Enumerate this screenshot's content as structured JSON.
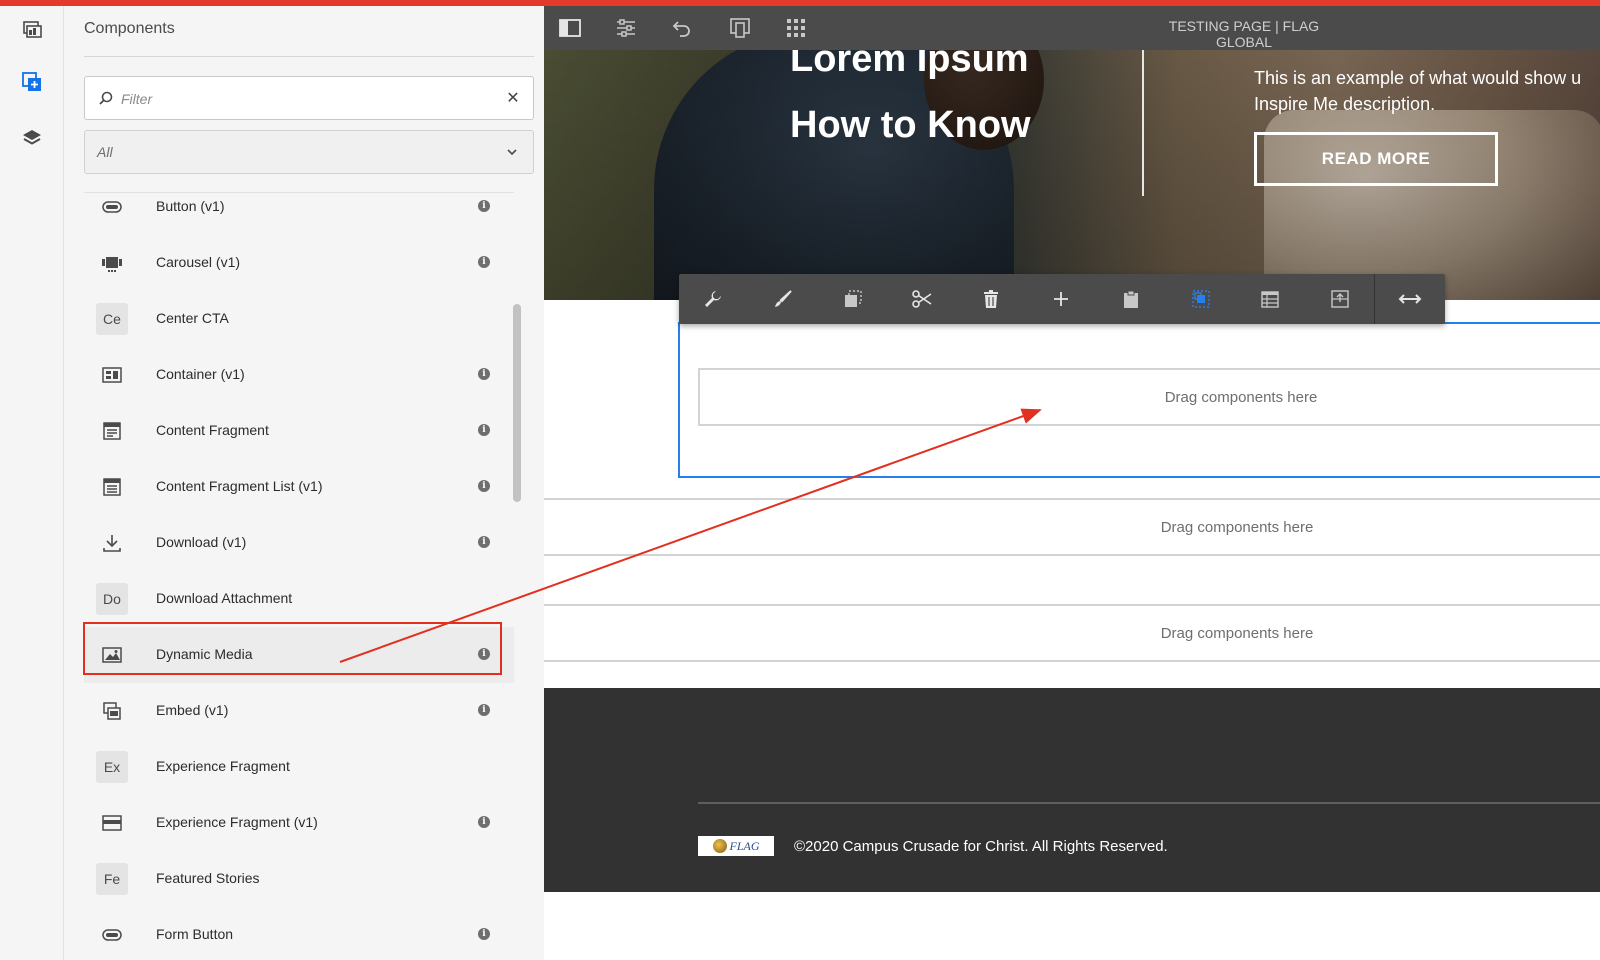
{
  "editor": {
    "page_title": "TESTING PAGE | FLAG GLOBAL"
  },
  "rail": {
    "items": [
      {
        "icon": "assets-icon"
      },
      {
        "icon": "components-icon",
        "active": true
      },
      {
        "icon": "content-tree-icon"
      }
    ]
  },
  "components_panel": {
    "title": "Components",
    "filter_placeholder": "Filter",
    "filter_value": "",
    "group_select": "All",
    "items": [
      {
        "label": "Button (v1)",
        "icon": "button-icon",
        "info": true
      },
      {
        "label": "Carousel (v1)",
        "icon": "carousel-icon",
        "info": true
      },
      {
        "label": "Center CTA",
        "abbr": "Ce",
        "info": false
      },
      {
        "label": "Container (v1)",
        "icon": "container-icon",
        "info": true
      },
      {
        "label": "Content Fragment",
        "icon": "content-fragment-icon",
        "info": true
      },
      {
        "label": "Content Fragment List (v1)",
        "icon": "content-fragment-list-icon",
        "info": true
      },
      {
        "label": "Download (v1)",
        "icon": "download-icon",
        "info": true
      },
      {
        "label": "Download Attachment",
        "abbr": "Do",
        "info": false
      },
      {
        "label": "Dynamic Media",
        "icon": "image-icon",
        "info": true,
        "highlighted": true
      },
      {
        "label": "Embed (v1)",
        "icon": "embed-icon",
        "info": true
      },
      {
        "label": "Experience Fragment",
        "abbr": "Ex",
        "info": false
      },
      {
        "label": "Experience Fragment (v1)",
        "icon": "experience-fragment-icon",
        "info": true
      },
      {
        "label": "Featured Stories",
        "abbr": "Fe",
        "info": false
      },
      {
        "label": "Form Button",
        "icon": "form-button-icon",
        "info": true
      }
    ]
  },
  "hero": {
    "title_line1": "Lorem Ipsum",
    "title_line2": "How to Know",
    "description": "This is an example of what would show u Inspire Me description.",
    "button": "READ MORE"
  },
  "drop_zones": {
    "label": "Drag components here"
  },
  "component_toolbar": {
    "actions": [
      "configure",
      "styles",
      "copy",
      "cut",
      "delete",
      "insert",
      "paste",
      "group",
      "layout",
      "parent",
      "resize"
    ]
  },
  "footer": {
    "logo_text": "FLAG",
    "copyright": "©2020 Campus Crusade for Christ. All Rights Reserved."
  },
  "colors": {
    "accent_red": "#e2301e",
    "selection_blue": "#2680eb",
    "toolbar_dark": "#4b4b4b",
    "footer_dark": "#323232"
  }
}
